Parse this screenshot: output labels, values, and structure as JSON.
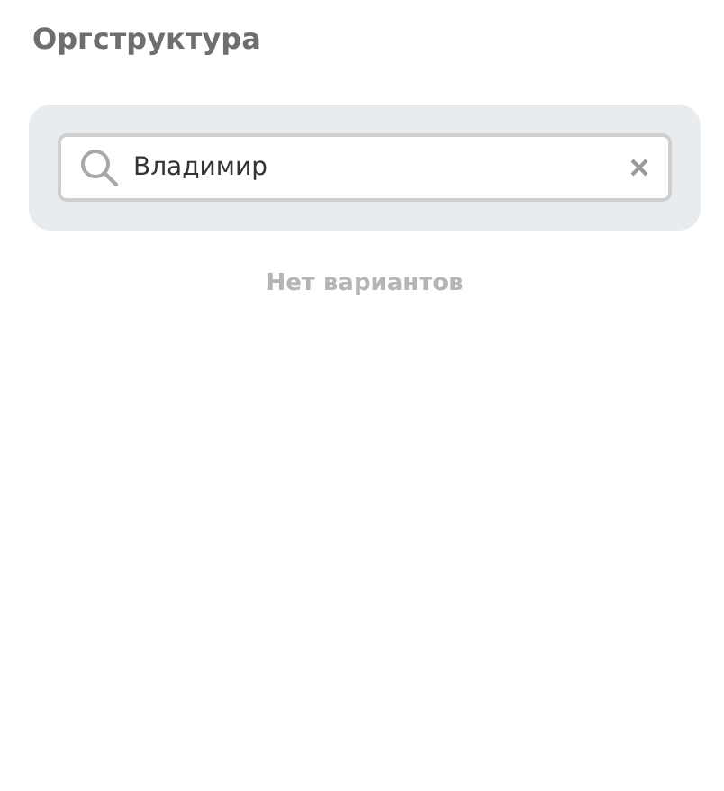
{
  "title": "Оргструктура",
  "search": {
    "value": "Владимир"
  },
  "empty_message": "Нет вариантов"
}
